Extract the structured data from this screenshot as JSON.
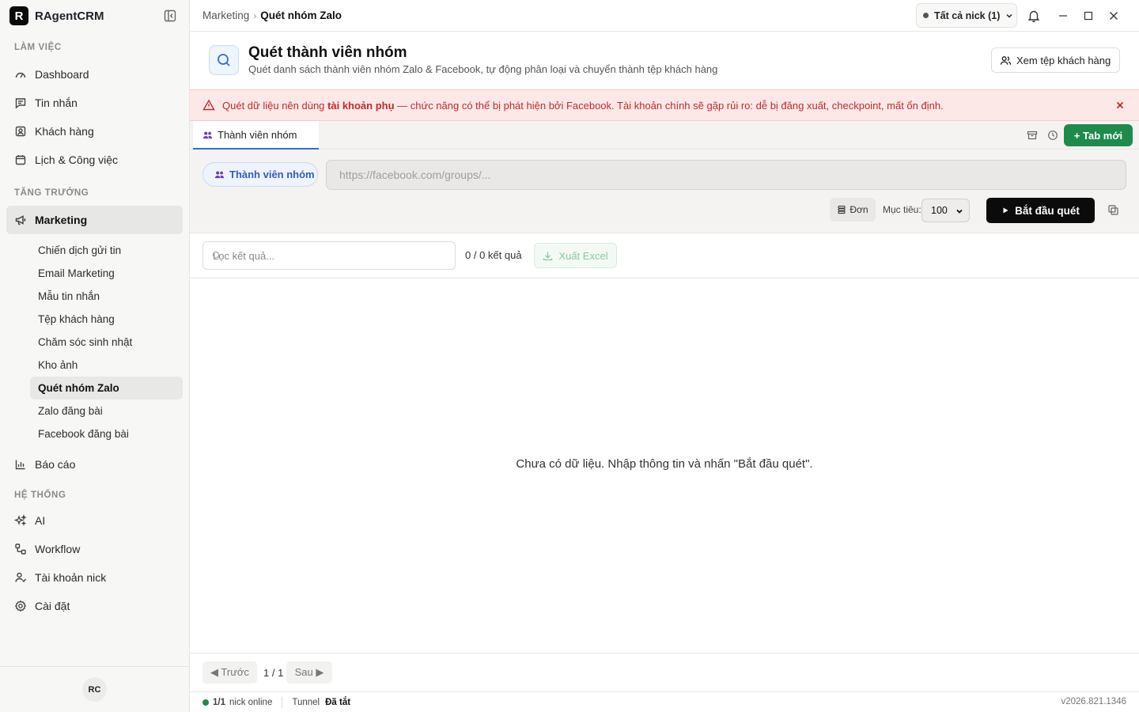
{
  "app": {
    "logo_letter": "R",
    "name": "RAgentCRM"
  },
  "sidebar": {
    "sections": {
      "work": "LÀM VIỆC",
      "growth": "TĂNG TRƯỞNG",
      "system": "HỆ THỐNG"
    },
    "work_items": [
      {
        "label": "Dashboard",
        "icon": "gauge-icon"
      },
      {
        "label": "Tin nhắn",
        "icon": "message-icon"
      },
      {
        "label": "Khách hàng",
        "icon": "contact-icon"
      },
      {
        "label": "Lịch & Công việc",
        "icon": "calendar-icon"
      }
    ],
    "marketing": {
      "label": "Marketing",
      "icon": "megaphone-icon"
    },
    "marketing_sub": [
      "Chiến dịch gửi tin",
      "Email Marketing",
      "Mẫu tin nhắn",
      "Tệp khách hàng",
      "Chăm sóc sinh nhật",
      "Kho ảnh",
      "Quét nhóm Zalo",
      "Zalo đăng bài",
      "Facebook đăng bài"
    ],
    "reports": {
      "label": "Báo cáo",
      "icon": "bar-chart-icon"
    },
    "system_items": [
      {
        "label": "AI",
        "icon": "sparkles-icon"
      },
      {
        "label": "Workflow",
        "icon": "workflow-icon"
      },
      {
        "label": "Tài khoản nick",
        "icon": "user-check-icon"
      },
      {
        "label": "Cài đặt",
        "icon": "gear-icon"
      }
    ],
    "avatar_initials": "RC"
  },
  "topbar": {
    "breadcrumb_parent": "Marketing",
    "breadcrumb_current": "Quét nhóm Zalo",
    "nick_selector": "Tất cả nick (1)"
  },
  "page": {
    "title": "Quét thành viên nhóm",
    "subtitle": "Quét danh sách thành viên nhóm Zalo & Facebook, tự động phân loại và chuyển thành tệp khách hàng",
    "view_customers_btn": "Xem tệp khách hàng"
  },
  "warning": {
    "prefix": "Quét dữ liệu nên dùng ",
    "bold": "tài khoản phụ",
    "suffix": " — chức năng có thể bị phát hiện bởi Facebook. Tài khoản chính sẽ gặp rủi ro: dễ bị đăng xuất, checkpoint, mất ổn định."
  },
  "tabs": {
    "active_tab": "Thành viên nhóm",
    "new_tab_btn": "+ Tab mới"
  },
  "scan": {
    "mode_pill": "Thành viên nhóm",
    "url_placeholder": "https://facebook.com/groups/...",
    "url_value": "",
    "single_btn": "Đơn",
    "target_label": "Mục tiêu:",
    "target_value": "100",
    "start_btn": "Bắt đầu quét"
  },
  "results": {
    "filter_placeholder": "Lọc kết quả...",
    "count_text": "0 / 0 kết quả",
    "export_btn": "Xuất Excel",
    "empty_message": "Chưa có dữ liệu. Nhập thông tin và nhấn \"Bắt đầu quét\"."
  },
  "pagination": {
    "prev": "◀ Trước",
    "indicator": "1 / 1",
    "next": "Sau ▶"
  },
  "status": {
    "nick_count": "1/1",
    "nick_label": "nick online",
    "tunnel_label": "Tunnel",
    "tunnel_state": "Đã tắt",
    "version": "v2026.821.1346"
  },
  "colors": {
    "accent_blue": "#2f6fd6",
    "success_green": "#1e8a4c",
    "warning_red": "#c22a2a",
    "warning_bg": "#fde8e8"
  }
}
